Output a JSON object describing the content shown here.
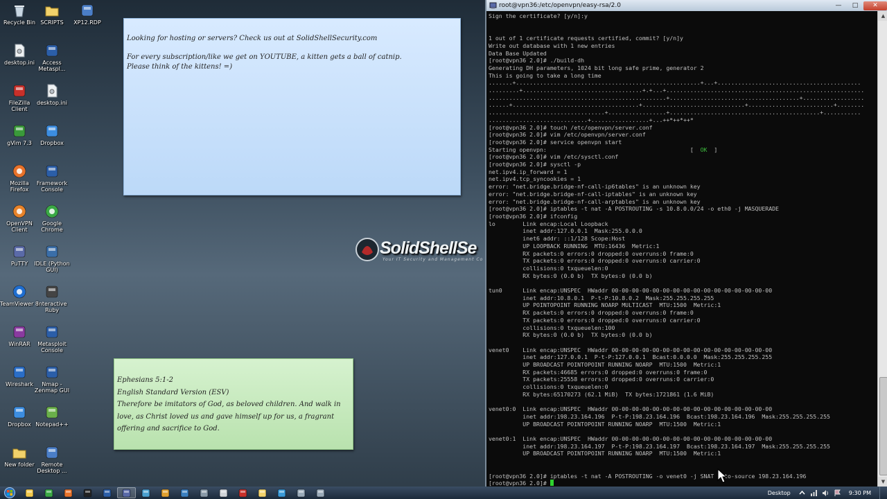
{
  "desktop_icons": [
    {
      "label": "Recycle Bin",
      "icon": "recycle-bin-icon",
      "color": "#c9d7e3"
    },
    {
      "label": "SCRIPTS",
      "icon": "folder-icon",
      "color": "#f2d26b"
    },
    {
      "label": "XP12.RDP",
      "icon": "remote-desktop-icon",
      "color": "#4a7ec8"
    },
    {
      "label": "desktop.ini",
      "icon": "settings-file-icon",
      "color": "#b8c0c8"
    },
    {
      "label": "Access Metaspl...",
      "icon": "metasploit-icon",
      "color": "#2b5ea8"
    },
    {
      "label": "FileZilla Client",
      "icon": "filezilla-icon",
      "color": "#c8302a"
    },
    {
      "label": "desktop.ini",
      "icon": "settings-file-icon",
      "color": "#b8c0c8"
    },
    {
      "label": "gVim 7.3",
      "icon": "gvim-icon",
      "color": "#3a9a3a"
    },
    {
      "label": "Dropbox",
      "icon": "dropbox-icon",
      "color": "#3c8de0"
    },
    {
      "label": "Mozilla Firefox",
      "icon": "firefox-icon",
      "color": "#e8722a"
    },
    {
      "label": "Framework Console",
      "icon": "metasploit-icon",
      "color": "#2b5ea8"
    },
    {
      "label": "OpenVPN Client",
      "icon": "openvpn-icon",
      "color": "#e8832a"
    },
    {
      "label": "Google Chrome",
      "icon": "chrome-icon",
      "color": "#3aa845"
    },
    {
      "label": "PuTTY",
      "icon": "putty-icon",
      "color": "#5a6aa8"
    },
    {
      "label": "IDLE (Python GUI)",
      "icon": "python-icon",
      "color": "#3a6ea8"
    },
    {
      "label": "TeamViewer 8",
      "icon": "teamviewer-icon",
      "color": "#1f6ed0"
    },
    {
      "label": "Interactive Ruby",
      "icon": "ruby-icon",
      "color": "#444444"
    },
    {
      "label": "WinRAR",
      "icon": "winrar-icon",
      "color": "#8a3aa0"
    },
    {
      "label": "Metasploit Console",
      "icon": "metasploit-icon",
      "color": "#2b5ea8"
    },
    {
      "label": "Wireshark",
      "icon": "wireshark-icon",
      "color": "#2a6ec8"
    },
    {
      "label": "Nmap - Zenmap GUI",
      "icon": "nmap-icon",
      "color": "#2b5ea8"
    },
    {
      "label": "Dropbox",
      "icon": "dropbox-icon",
      "color": "#3c8de0"
    },
    {
      "label": "Notepad++",
      "icon": "notepad-plus-icon",
      "color": "#6ab04a"
    },
    {
      "label": "New folder",
      "icon": "folder-icon",
      "color": "#f2d26b"
    },
    {
      "label": "Remote Desktop ...",
      "icon": "remote-desktop-icon",
      "color": "#4a7ec8"
    }
  ],
  "note_blue": {
    "line1": "Looking for hosting or servers? Check us out at SolidShellSecurity.com",
    "line2": "For every subscription/like we get on YOUTUBE, a kitten gets a ball of catnip.",
    "line3": "Please think of the kittens! =)"
  },
  "note_green": {
    "line1": "Ephesians 5:1-2",
    "line2": "English Standard Version (ESV)",
    "line3": "Therefore be imitators of God, as beloved children. And walk in",
    "line4": "love, as Christ loved us and gave himself up for us, a fragrant",
    "line5": "offering and sacrifice to God."
  },
  "watermark": {
    "brand": "SolidShellSe",
    "tagline": "Your IT Security and Management Co"
  },
  "putty": {
    "title": "root@vpn36:/etc/openvpn/easy-rsa/2.0",
    "ok_label": "OK",
    "lines": [
      "Sign the certificate? [y/n]:y",
      "",
      "",
      "1 out of 1 certificate requests certified, commit? [y/n]y",
      "Write out database with 1 new entries",
      "Data Base Updated",
      "[root@vpn36 2.0]# ./build-dh",
      "Generating DH parameters, 1024 bit long safe prime, generator 2",
      "This is going to take a long time",
      ".......+......................................................+...+..........................................",
      ".........+...................................+.+...+..........................................................",
      "....................................................+......................................+..................",
      "......+.....................................+..............................+.........................+........",
      "..................................+.................+............................................+...........",
      ".............................+.................+...++*++*++*",
      "[root@vpn36 2.0]# touch /etc/openvpn/server.conf",
      "[root@vpn36 2.0]# vim /etc/openvpn/server.conf",
      "[root@vpn36 2.0]# service openvpn start",
      "Starting openvpn:                                          [  OK  ]",
      "[root@vpn36 2.0]# vim /etc/sysctl.conf",
      "[root@vpn36 2.0]# sysctl -p",
      "net.ipv4.ip_forward = 1",
      "net.ipv4.tcp_syncookies = 1",
      "error: \"net.bridge.bridge-nf-call-ip6tables\" is an unknown key",
      "error: \"net.bridge.bridge-nf-call-iptables\" is an unknown key",
      "error: \"net.bridge.bridge-nf-call-arptables\" is an unknown key",
      "[root@vpn36 2.0]# iptables -t nat -A POSTROUTING -s 10.8.0.0/24 -o eth0 -j MASQUERADE",
      "[root@vpn36 2.0]# ifconfig",
      "lo        Link encap:Local Loopback",
      "          inet addr:127.0.0.1  Mask:255.0.0.0",
      "          inet6 addr: ::1/128 Scope:Host",
      "          UP LOOPBACK RUNNING  MTU:16436  Metric:1",
      "          RX packets:0 errors:0 dropped:0 overruns:0 frame:0",
      "          TX packets:0 errors:0 dropped:0 overruns:0 carrier:0",
      "          collisions:0 txqueuelen:0",
      "          RX bytes:0 (0.0 b)  TX bytes:0 (0.0 b)",
      "",
      "tun0      Link encap:UNSPEC  HWaddr 00-00-00-00-00-00-00-00-00-00-00-00-00-00-00-00",
      "          inet addr:10.8.0.1  P-t-P:10.8.0.2  Mask:255.255.255.255",
      "          UP POINTOPOINT RUNNING NOARP MULTICAST  MTU:1500  Metric:1",
      "          RX packets:0 errors:0 dropped:0 overruns:0 frame:0",
      "          TX packets:0 errors:0 dropped:0 overruns:0 carrier:0",
      "          collisions:0 txqueuelen:100",
      "          RX bytes:0 (0.0 b)  TX bytes:0 (0.0 b)",
      "",
      "venet0    Link encap:UNSPEC  HWaddr 00-00-00-00-00-00-00-00-00-00-00-00-00-00-00-00",
      "          inet addr:127.0.0.1  P-t-P:127.0.0.1  Bcast:0.0.0.0  Mask:255.255.255.255",
      "          UP BROADCAST POINTOPOINT RUNNING NOARP  MTU:1500  Metric:1",
      "          RX packets:46685 errors:0 dropped:0 overruns:0 frame:0",
      "          TX packets:25558 errors:0 dropped:0 overruns:0 carrier:0",
      "          collisions:0 txqueuelen:0",
      "          RX bytes:65170273 (62.1 MiB)  TX bytes:1721861 (1.6 MiB)",
      "",
      "venet0:0  Link encap:UNSPEC  HWaddr 00-00-00-00-00-00-00-00-00-00-00-00-00-00-00-00",
      "          inet addr:198.23.164.196  P-t-P:198.23.164.196  Bcast:198.23.164.196  Mask:255.255.255.255",
      "          UP BROADCAST POINTOPOINT RUNNING NOARP  MTU:1500  Metric:1",
      "",
      "venet0:1  Link encap:UNSPEC  HWaddr 00-00-00-00-00-00-00-00-00-00-00-00-00-00-00-00",
      "          inet addr:198.23.164.197  P-t-P:198.23.164.197  Bcast:198.23.164.197  Mask:255.255.255.255",
      "          UP BROADCAST POINTOPOINT RUNNING NOARP  MTU:1500  Metric:1",
      "",
      "",
      "[root@vpn36 2.0]# iptables -t nat -A POSTROUTING -o venet0 -j SNAT --to-source 198.23.164.196",
      "[root@vpn36 2.0]# "
    ]
  },
  "taskbar": {
    "apps": [
      {
        "icon": "explorer-icon",
        "color": "#f2c94c",
        "active": false
      },
      {
        "icon": "chrome-icon",
        "color": "#3aa845",
        "active": false
      },
      {
        "icon": "firefox-icon",
        "color": "#e8722a",
        "active": false
      },
      {
        "icon": "command-prompt-icon",
        "color": "#222222",
        "active": false
      },
      {
        "icon": "metasploit-icon",
        "color": "#2b5ea8",
        "active": false
      },
      {
        "icon": "putty-icon",
        "color": "#5a6aa8",
        "active": true
      },
      {
        "icon": "network-icon",
        "color": "#4aa0d0",
        "active": false
      },
      {
        "icon": "paint-icon",
        "color": "#e0a030",
        "active": false
      },
      {
        "icon": "vm-icon",
        "color": "#3a7fc0",
        "active": false
      },
      {
        "icon": "settings-icon",
        "color": "#8a9aa8",
        "active": false
      },
      {
        "icon": "mail-icon",
        "color": "#d0d4d8",
        "active": false
      },
      {
        "icon": "filezilla-icon",
        "color": "#c8302a",
        "active": false
      },
      {
        "icon": "folder-icon",
        "color": "#f2d26b",
        "active": false
      },
      {
        "icon": "vnc-icon",
        "color": "#3a9ad8",
        "active": false
      },
      {
        "icon": "window-icon",
        "color": "#9aaab8",
        "active": false
      },
      {
        "icon": "window-icon",
        "color": "#9aaab8",
        "active": false
      }
    ],
    "tray_label": "Desktop",
    "clock": "9:30 PM"
  }
}
